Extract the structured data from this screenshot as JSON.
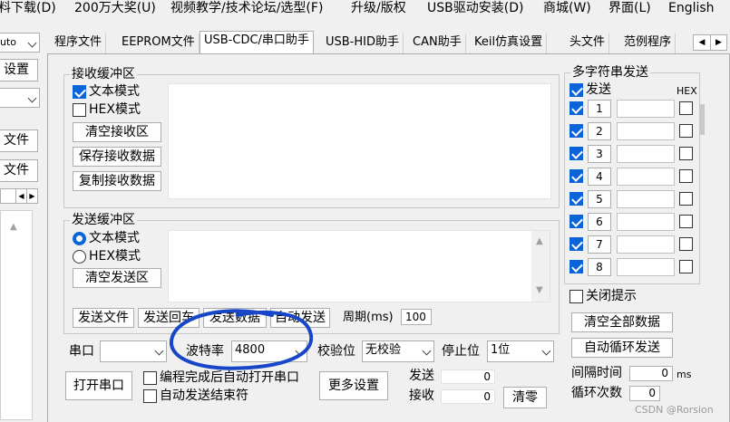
{
  "menu": [
    "料下载(D)",
    "200万大奖(U)",
    "视频教学/技术论坛/选型(F)",
    "升级/版权",
    "USB驱动安装(D)",
    "商城(W)",
    "界面(L)",
    "English"
  ],
  "left": {
    "combo_value": "uto",
    "settings_button": "设置",
    "file_button_1": "文件",
    "file_button_2": "文件"
  },
  "tabs": [
    "程序文件",
    "EEPROM文件",
    "USB-CDC/串口助手",
    "USB-HID助手",
    "CAN助手",
    "Keil仿真设置",
    "头文件",
    "范例程序"
  ],
  "tab_scroll": {
    "left": "◀",
    "right": "▶"
  },
  "receive": {
    "title": "接收缓冲区",
    "text_mode": "文本模式",
    "hex_mode": "HEX模式",
    "clear": "清空接收区",
    "save": "保存接收数据",
    "copy": "复制接收数据"
  },
  "send": {
    "title": "发送缓冲区",
    "text_mode": "文本模式",
    "hex_mode": "HEX模式",
    "clear": "清空发送区",
    "send_file": "发送文件",
    "send_enter": "发送回车",
    "send_data": "发送数据",
    "auto_send": "自动发送",
    "period_label": "周期(ms)",
    "period_value": "100"
  },
  "serial": {
    "port_label": "串口",
    "port_value": "",
    "baud_label": "波特率",
    "baud_value": "4800",
    "parity_label": "校验位",
    "parity_value": "无校验",
    "stop_label": "停止位",
    "stop_value": "1位",
    "open": "打开串口",
    "auto_open": "编程完成后自动打开串口",
    "auto_end": "自动发送结束符",
    "more": "更多设置",
    "sent_label": "发送",
    "sent_value": "0",
    "recv_label": "接收",
    "recv_value": "0",
    "clear_count": "清零"
  },
  "multi": {
    "title": "多字符串发送",
    "send_label": "发送",
    "hex_label": "HEX",
    "rows": [
      "1",
      "2",
      "3",
      "4",
      "5",
      "6",
      "7",
      "8"
    ],
    "close_hint": "关闭提示",
    "clear_all": "清空全部数据",
    "auto_loop": "自动循环发送",
    "interval_label": "间隔时间",
    "interval_value": "0",
    "interval_unit": "ms",
    "loop_label": "循环次数",
    "loop_value": "0"
  },
  "watermark": "CSDN @Rorsion",
  "annotation_color": "#1846c8",
  "accent": "#0a64d8"
}
